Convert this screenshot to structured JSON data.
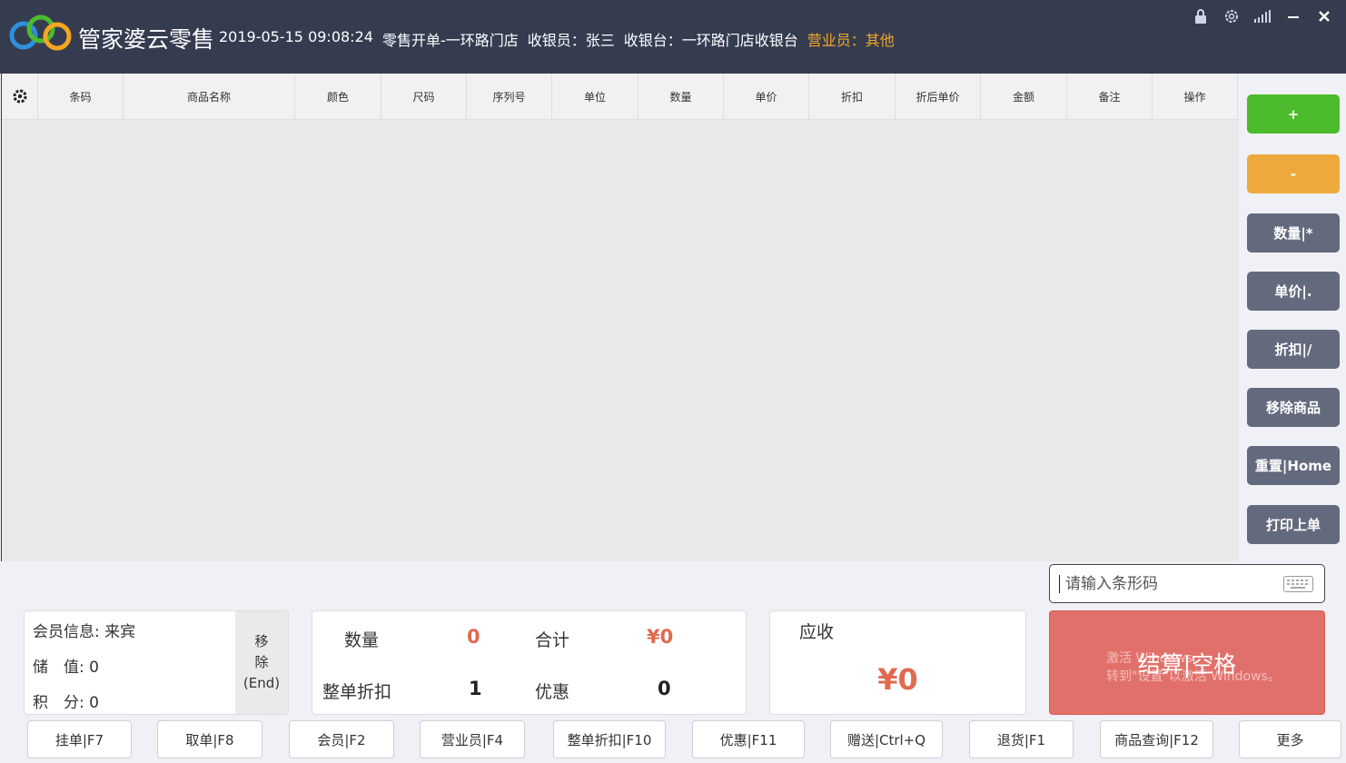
{
  "header": {
    "app_name": "管家婆云零售",
    "datetime": "2019-05-15 09:08:24",
    "mode": "零售开单",
    "store": "-一环路门店",
    "cashier": "收银员：张三",
    "register": "收银台：一环路门店收银台",
    "salesperson": "营业员：其他"
  },
  "window_icons": [
    "lock-icon",
    "settings-icon",
    "signal-icon",
    "minimize-icon",
    "close-icon"
  ],
  "table": {
    "columns": [
      {
        "label": "条码",
        "w": 94
      },
      {
        "label": "商品名称",
        "w": 189
      },
      {
        "label": "颜色",
        "w": 95
      },
      {
        "label": "尺码",
        "w": 94
      },
      {
        "label": "序列号",
        "w": 94
      },
      {
        "label": "单位",
        "w": 95
      },
      {
        "label": "数量",
        "w": 94
      },
      {
        "label": "单价",
        "w": 94
      },
      {
        "label": "折扣",
        "w": 95
      },
      {
        "label": "折后单价",
        "w": 94
      },
      {
        "label": "金额",
        "w": 95
      },
      {
        "label": "备注",
        "w": 94
      },
      {
        "label": "操作",
        "w": 94
      }
    ]
  },
  "side_buttons": [
    {
      "label": "+",
      "style": "green"
    },
    {
      "label": "-",
      "style": "orange"
    },
    {
      "label": "数量|*",
      "style": ""
    },
    {
      "label": "单价|.",
      "style": ""
    },
    {
      "label": "折扣|/",
      "style": ""
    },
    {
      "label": "移除商品",
      "style": ""
    },
    {
      "label": "重置|Home",
      "style": ""
    },
    {
      "label": "打印上单",
      "style": ""
    }
  ],
  "barcode": {
    "placeholder": "请输入条形码"
  },
  "member": {
    "info_label": "会员信息:",
    "info_value": "来宾",
    "stored_label": "储　值:",
    "stored_value": "0",
    "points_label": "积　分:",
    "points_value": "0",
    "remove_line1": "移",
    "remove_line2": "除",
    "remove_line3": "(End)"
  },
  "totals": {
    "qty_label": "数量",
    "qty_value": "0",
    "sum_label": "合计",
    "sum_value": "¥0",
    "discount_label": "整单折扣",
    "discount_value": "1",
    "promo_label": "优惠",
    "promo_value": "0"
  },
  "receivable": {
    "label": "应收",
    "amount": "¥0"
  },
  "checkout": {
    "label": "结算|空格",
    "watermark_line1": "激活 Windows",
    "watermark_line2": "转到\"设置\"以激活 Windows。"
  },
  "fn_buttons": [
    {
      "label": "挂单|F7"
    },
    {
      "label": "取单|F8"
    },
    {
      "label": "会员|F2"
    },
    {
      "label": "营业员|F4"
    },
    {
      "label": "整单折扣|F10"
    },
    {
      "label": "优惠|F11"
    },
    {
      "label": "赠送|Ctrl+Q"
    },
    {
      "label": "退货|F1"
    },
    {
      "label": "商品查询|F12"
    },
    {
      "label": "更多"
    }
  ]
}
